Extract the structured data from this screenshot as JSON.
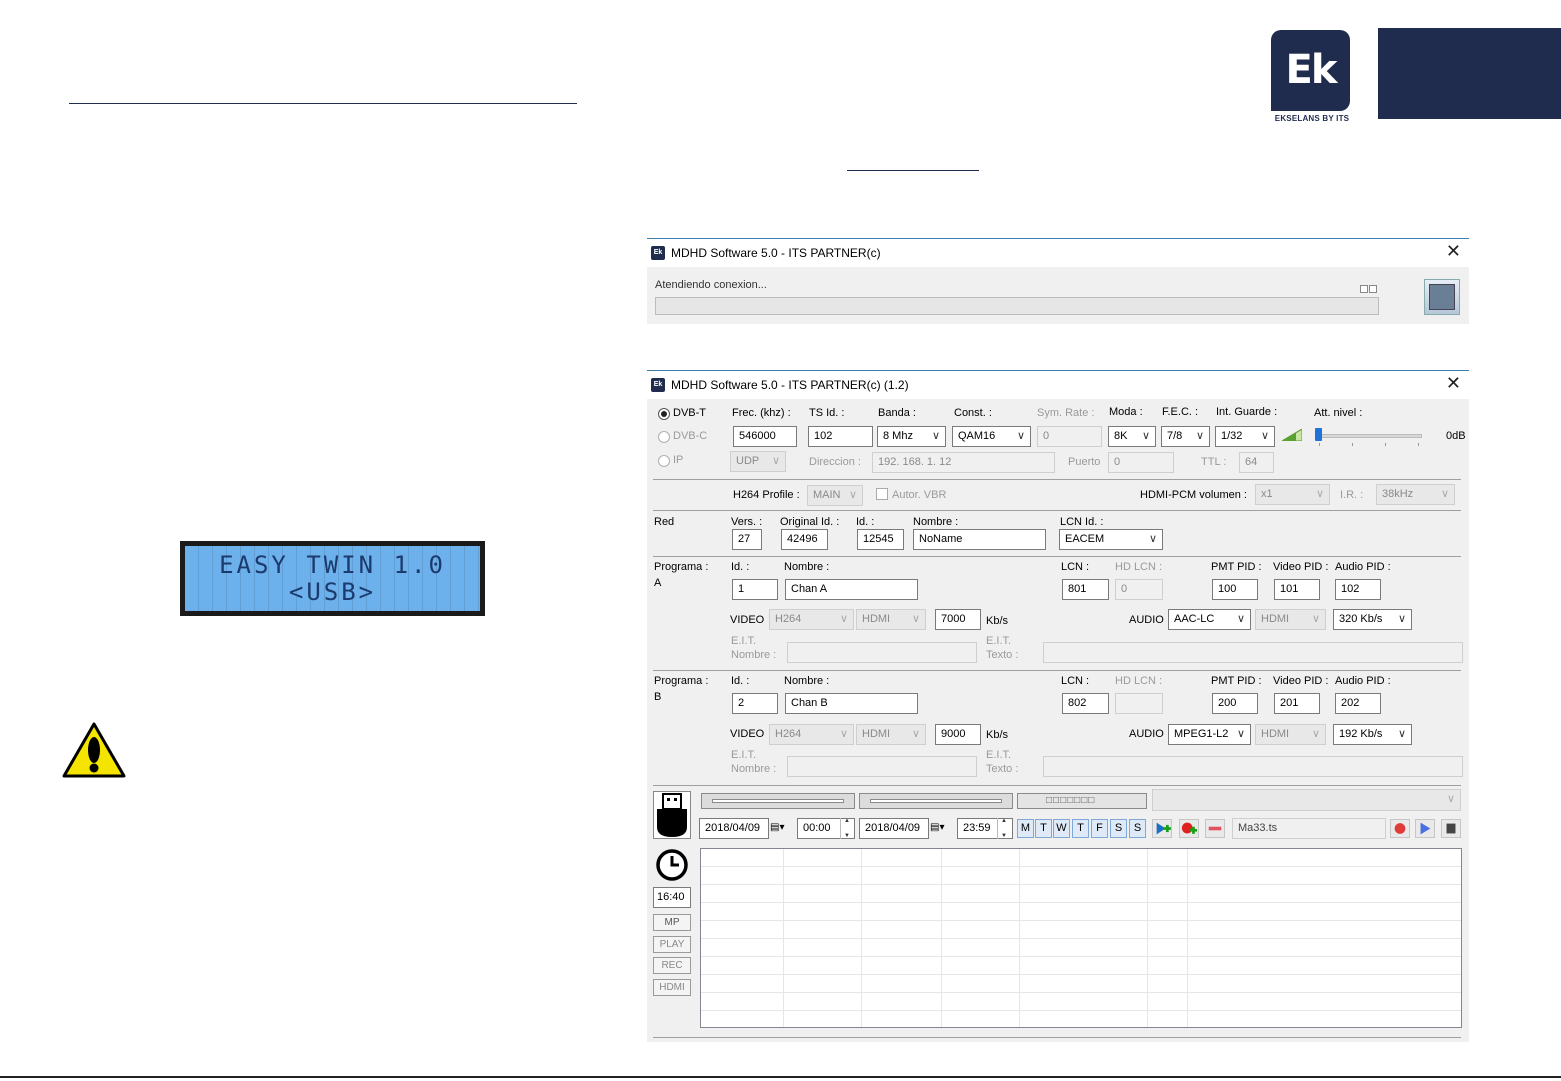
{
  "brand": {
    "logo_text": "Ek",
    "tagline": "EKSELANS BY ITS",
    "navy_color": "#1f2c4d"
  },
  "lcd": {
    "line1": "EASY TWIN 1.0",
    "line2": "<USB>"
  },
  "dialog1": {
    "title": "MDHD Software 5.0 - ITS PARTNER(c)",
    "status": "Atendiendo conexion...",
    "icon": "ek-app-icon",
    "close_icon": "close-icon"
  },
  "dialog2": {
    "title": "MDHD Software 5.0 - ITS PARTNER(c) (1.2)",
    "modes": [
      {
        "label": "DVB-T",
        "selected": true,
        "enabled": true
      },
      {
        "label": "DVB-C",
        "selected": false,
        "enabled": false
      },
      {
        "label": "IP",
        "selected": false,
        "enabled": false
      }
    ],
    "tx": {
      "freq_label": "Frec. (khz) :",
      "freq_value": "546000",
      "tsid_label": "TS Id. :",
      "tsid_value": "102",
      "banda_label": "Banda :",
      "banda_value": "8 Mhz",
      "const_label": "Const. :",
      "const_value": "QAM16",
      "symrate_label": "Sym. Rate :",
      "symrate_value": "0",
      "moda_label": "Moda :",
      "moda_value": "8K",
      "fec_label": "F.E.C. :",
      "fec_value": "7/8",
      "guard_label": "Int. Guarde :",
      "guard_value": "1/32",
      "att_label": "Att. nivel :",
      "att_value": "0dB",
      "proto_value": "UDP",
      "dir_label": "Direccion :",
      "dir_value": "192. 168. 1. 12",
      "puerto_label": "Puerto",
      "puerto_value": "0",
      "ttl_label": "TTL :",
      "ttl_value": "64"
    },
    "h264": {
      "profile_label": "H264 Profile :",
      "profile_value": "MAIN",
      "vbr_label": "Autor. VBR",
      "hdmi_vol_label": "HDMI-PCM volumen :",
      "hdmi_vol_value": "x1",
      "ir_label": "I.R. :",
      "ir_value": "38kHz"
    },
    "red": {
      "section_label": "Red",
      "vers_label": "Vers. :",
      "vers_value": "27",
      "origid_label": "Original Id. :",
      "origid_value": "42496",
      "id_label": "Id. :",
      "id_value": "12545",
      "nombre_label": "Nombre :",
      "nombre_value": "NoName",
      "lcnid_label": "LCN Id. :",
      "lcnid_value": "EACEM"
    },
    "programs": [
      {
        "section_label": "Programa :",
        "letter": "A",
        "id_label": "Id. :",
        "id_value": "1",
        "nombre_label": "Nombre :",
        "nombre_value": "Chan A",
        "lcn_label": "LCN :",
        "lcn_value": "801",
        "hdlcn_label": "HD LCN :",
        "hdlcn_value": "0",
        "pmt_label": "PMT PID :",
        "pmt_value": "100",
        "video_pid_label": "Video PID :",
        "video_pid_value": "101",
        "audio_pid_label": "Audio PID :",
        "audio_pid_value": "102",
        "video_label": "VIDEO",
        "video_codec": "H264",
        "video_src": "HDMI",
        "video_rate": "7000",
        "video_unit": "Kb/s",
        "audio_label": "AUDIO",
        "audio_codec": "AAC-LC",
        "audio_src": "HDMI",
        "audio_rate": "320  Kb/s",
        "eit_label": "E.I.T.",
        "eit_nombre_label": "Nombre :",
        "eit_texto_label": "Texto :"
      },
      {
        "section_label": "Programa :",
        "letter": "B",
        "id_label": "Id. :",
        "id_value": "2",
        "nombre_label": "Nombre :",
        "nombre_value": "Chan B",
        "lcn_label": "LCN :",
        "lcn_value": "802",
        "hdlcn_label": "HD LCN :",
        "hdlcn_value": "",
        "pmt_label": "PMT PID :",
        "pmt_value": "200",
        "video_pid_label": "Video PID :",
        "video_pid_value": "201",
        "audio_pid_label": "Audio PID :",
        "audio_pid_value": "202",
        "video_label": "VIDEO",
        "video_codec": "H264",
        "video_src": "HDMI",
        "video_rate": "9000",
        "video_unit": "Kb/s",
        "audio_label": "AUDIO",
        "audio_codec": "MPEG1-L2",
        "audio_src": "HDMI",
        "audio_rate": "192 Kb/s",
        "eit_label": "E.I.T.",
        "eit_nombre_label": "Nombre :",
        "eit_texto_label": "Texto :"
      }
    ],
    "schedule": {
      "start_date": "2018/04/09",
      "start_time": "00:00",
      "end_date": "2018/04/09",
      "end_time": "23:59",
      "days": [
        "M",
        "T",
        "W",
        "T",
        "F",
        "S",
        "S"
      ],
      "file_name": "Ma33.ts",
      "clock": "16:40",
      "side_buttons": [
        "MP",
        "PLAY",
        "REC",
        "HDMI"
      ]
    }
  }
}
